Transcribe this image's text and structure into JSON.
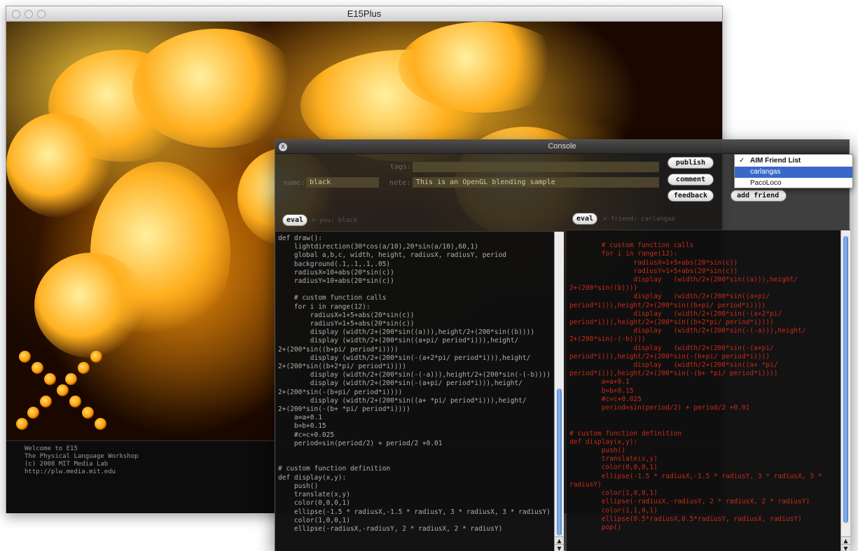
{
  "main_window": {
    "title": "E15Plus",
    "log_lines": [
      "Welcome to E15",
      "The Physical Language Workshop",
      "(c) 2008 MIT Media Lab",
      "http://plw.media.mit.edu"
    ]
  },
  "console": {
    "title": "Console",
    "close_icon": "x",
    "fields": {
      "tags_label": "tags:",
      "tags_value": "",
      "name_label": "name:",
      "name_value": "black",
      "note_label": "note:",
      "note_value": "This is an OpenGL blending sample"
    },
    "buttons": {
      "publish": "publish",
      "comment": "comment",
      "feedback": "feedback",
      "add_friend": "add friend",
      "eval_left": "eval",
      "eval_right": "eval"
    },
    "left_pane": {
      "label": "> you: black",
      "code": [
        "def draw():",
        "    lightdirection(30*cos(a/10),20*sin(a/10),60,1)",
        "    global a,b,c, width, height, radiusX, radiusY, period",
        "    background(.1,.1,.1,.05)",
        "    radiusX=10+abs(20*sin(c))",
        "    radiusY=10+abs(20*sin(c))",
        "",
        "    # custom function calls",
        "    for i in range(12):",
        "        radiusX=1+5+abs(20*sin(c))",
        "        radiusY=1+5+abs(20*sin(c))",
        "        display (width/2+(200*sin((a))),height/2+(200*sin((b))))",
        "        display (width/2+(200*sin((a+pi/ period*i))),height/",
        "2+(200*sin((b+pi/ period*i))))",
        "        display (width/2+(200*sin(-(a+2*pi/ period*i))),height/",
        "2+(200*sin((b+2*pi/ period*i))))",
        "        display (width/2+(200*sin(-(-a))),height/2+(200*sin(-(-b))))",
        "        display (width/2+(200*sin(-(a+pi/ period*i))),height/",
        "2+(200*sin(-(b+pi/ period*i))))",
        "        display (width/2+(200*sin((a+ *pi/ period*i))),height/",
        "2+(200*sin(-(b+ *pi/ period*i))))",
        "    a=a+0.1",
        "    b=b+0.15",
        "    #c=c+0.025",
        "    period=sin(period/2) + period/2 +0.01",
        "",
        "",
        "# custom function definition",
        "def display(x,y):",
        "    push()",
        "    translate(x,y)",
        "    color(0,0,0,1)",
        "    ellipse(-1.5 * radiusX,-1.5 * radiusY, 3 * radiusX, 3 * radiusY)",
        "    color(1,0,0,1)",
        "    ellipse(-radiusX,-radiusY, 2 * radiusX, 2 * radiusY)"
      ]
    },
    "right_pane": {
      "label": "> friend: carlangas",
      "code": [
        "",
        "        # custom function calls",
        "        for i in range(12):",
        "                radiusX=1+5+abs(20*sin(c))",
        "                radiusY=1+5+abs(20*sin(c))",
        "                display   (width/2+(200*sin((a))),height/",
        "2+(200*sin((b))))",
        "                display   (width/2+(200*sin((a+pi/",
        "period*i))),height/2+(200*sin((b+pi/ period*i))))",
        "                display   (width/2+(200*sin(-(a+2*pi/",
        "period*i))),height/2+(200*sin((b+2*pi/ period*i))))",
        "                display   (width/2+(200*sin(-(-a))),height/",
        "2+(200*sin(-(-b))))",
        "                display   (width/2+(200*sin(-(a+pi/",
        "period*i))),height/2+(200*sin(-(b+pi/ period*i))))",
        "                display   (width/2+(200*sin((a+ *pi/",
        "period*i))),height/2+(200*sin(-(b+ *pi/ period*i))))",
        "        a=a+0.1",
        "        b=b+0.15",
        "        #c=c+0.025",
        "        period=sin(period/2) + period/2 +0.01",
        "",
        "",
        "# custom function definition",
        "def display(x,y):",
        "        push()",
        "        translate(x,y)",
        "        color(0,0,0,1)",
        "        ellipse(-1.5 * radiusX,-1.5 * radiusY, 3 * radiusX, 3 *",
        "radiusY)",
        "        color(1,0,0,1)",
        "        ellipse(-radiusX,-radiusY, 2 * radiusX, 2 * radiusY)",
        "        color(1,1,0,1)",
        "        ellipse(0.5*radiusX,0.5*radiusY, radiusX, radiusY)",
        "        pop()"
      ]
    }
  },
  "friend_dropdown": {
    "items": [
      {
        "label": "AIM Friend List",
        "checked": true,
        "selected": false
      },
      {
        "label": "carlangas",
        "checked": false,
        "selected": true
      },
      {
        "label": "PacoLoco",
        "checked": false,
        "selected": false
      }
    ]
  },
  "colors": {
    "selection": "#3a68c8",
    "code_left": "#b0b0b0",
    "code_right": "#c92a1a",
    "scroll_thumb": "#5a8bd6"
  }
}
